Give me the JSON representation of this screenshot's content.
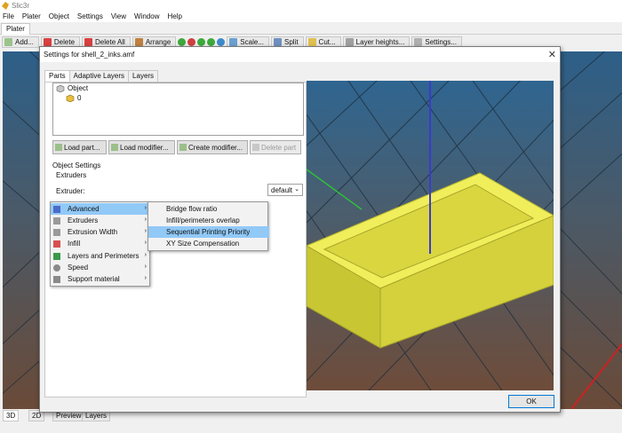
{
  "app": {
    "title": "Slic3r"
  },
  "menubar": [
    "File",
    "Plater",
    "Object",
    "Settings",
    "View",
    "Window",
    "Help"
  ],
  "main_tabs": {
    "plater": "Plater"
  },
  "toolbar": {
    "add": "Add...",
    "delete": "Delete",
    "delete_all": "Delete All",
    "arrange": "Arrange",
    "scale": "Scale...",
    "split": "Split",
    "cut": "Cut...",
    "layer_heights": "Layer heights...",
    "settings": "Settings..."
  },
  "bottom_tabs": [
    "3D",
    "2D",
    "Preview",
    "Layers"
  ],
  "dialog": {
    "title": "Settings for shell_2_inks.amf",
    "tabs": [
      "Parts",
      "Adaptive Layers",
      "Layers"
    ],
    "tree": {
      "root": "Object",
      "child": "0"
    },
    "buttons": {
      "load_part": "Load part...",
      "load_modifier": "Load modifier...",
      "create_modifier": "Create modifier...",
      "delete_part": "Delete part"
    },
    "object_settings_label": "Object Settings",
    "extruders_group": "Extruders",
    "extruder_label": "Extruder:",
    "extruder_value": "default",
    "ok": "OK",
    "context_menu": [
      {
        "label": "Advanced",
        "icon": "wand-icon"
      },
      {
        "label": "Extruders",
        "icon": "funnel-icon"
      },
      {
        "label": "Extrusion Width",
        "icon": "funnel-icon"
      },
      {
        "label": "Infill",
        "icon": "infill-icon"
      },
      {
        "label": "Layers and Perimeters",
        "icon": "layers-icon"
      },
      {
        "label": "Speed",
        "icon": "clock-icon"
      },
      {
        "label": "Support material",
        "icon": "support-icon"
      }
    ],
    "submenu": [
      "Bridge flow ratio",
      "Infill/perimeters overlap",
      "Sequential Printing Priority",
      "XY Size Compensation"
    ],
    "highlighted_submenu_item": "Sequential Printing Priority"
  },
  "colors": {
    "model_yellow": "#e6e44a",
    "menu_highlight": "#91c9f7",
    "axis_blue": "#3a3acc",
    "axis_green": "#2fbf3a",
    "axis_red": "#cc2222"
  }
}
